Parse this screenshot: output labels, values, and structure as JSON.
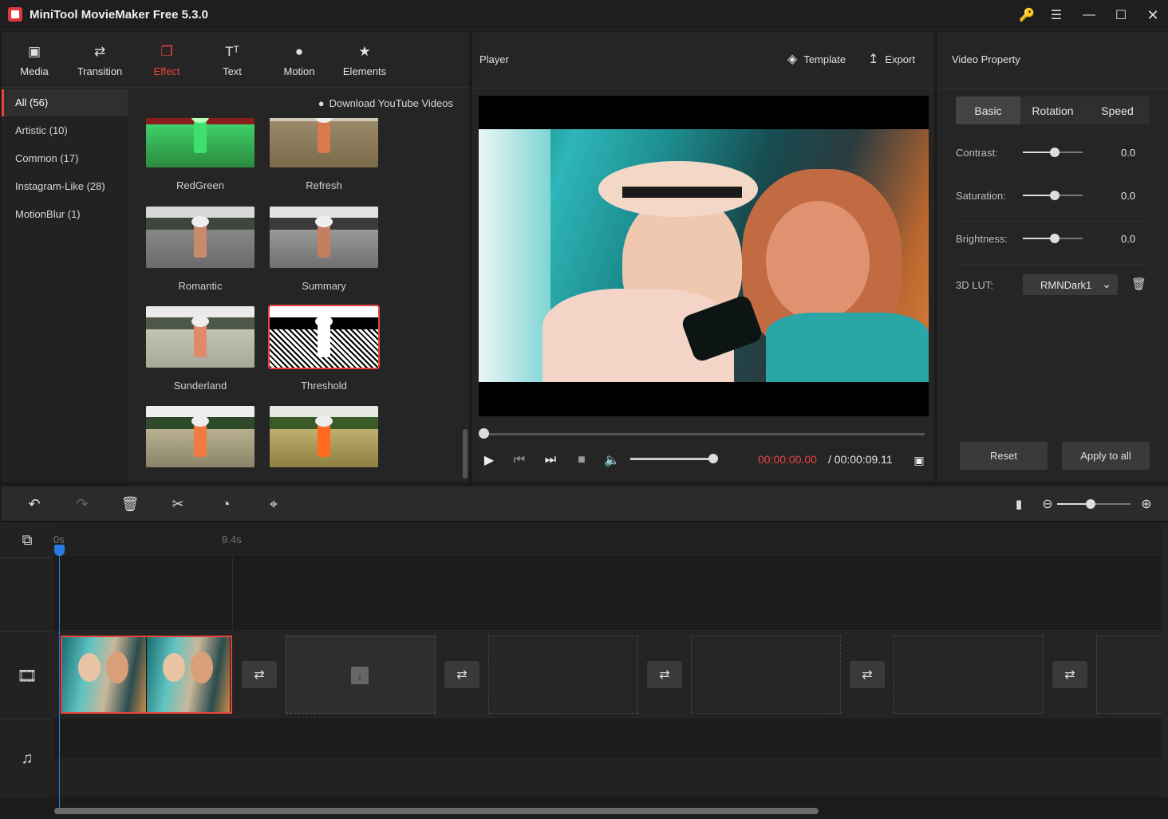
{
  "window": {
    "title": "MiniTool MovieMaker Free 5.3.0",
    "controls": [
      "key-icon",
      "menu-icon",
      "minimize-icon",
      "maximize-icon",
      "close-icon"
    ]
  },
  "library": {
    "tabs": [
      {
        "label": "Media",
        "icon": "media-icon"
      },
      {
        "label": "Transition",
        "icon": "transition-icon"
      },
      {
        "label": "Effect",
        "icon": "effect-icon",
        "active": true
      },
      {
        "label": "Text",
        "icon": "text-icon"
      },
      {
        "label": "Motion",
        "icon": "motion-icon"
      },
      {
        "label": "Elements",
        "icon": "elements-icon"
      }
    ],
    "categories": [
      {
        "label": "All (56)",
        "active": true
      },
      {
        "label": "Artistic (10)"
      },
      {
        "label": "Common (17)"
      },
      {
        "label": "Instagram-Like (28)"
      },
      {
        "label": "MotionBlur (1)"
      }
    ],
    "download_link": "Download YouTube Videos",
    "effects": [
      {
        "label": "RedGreen"
      },
      {
        "label": "Refresh"
      },
      {
        "label": "Romantic"
      },
      {
        "label": "Summary"
      },
      {
        "label": "Sunderland"
      },
      {
        "label": "Threshold",
        "selected": true
      },
      {
        "label": ""
      },
      {
        "label": ""
      }
    ]
  },
  "player": {
    "title": "Player",
    "template_label": "Template",
    "export_label": "Export",
    "time_current": "00:00:00.00",
    "time_total": "/ 00:00:09.11",
    "progress": 0.0,
    "volume": 1.0
  },
  "property": {
    "title": "Video Property",
    "tabs": [
      {
        "label": "Basic",
        "active": true
      },
      {
        "label": "Rotation"
      },
      {
        "label": "Speed"
      }
    ],
    "rows": [
      {
        "label": "Contrast:",
        "value": "0.0"
      },
      {
        "label": "Saturation:",
        "value": "0.0"
      },
      {
        "label": "Brightness:",
        "value": "0.0"
      }
    ],
    "lut_label": "3D LUT:",
    "lut_value": "RMNDark1",
    "reset_label": "Reset",
    "apply_all_label": "Apply to all"
  },
  "timeline": {
    "ruler": [
      "0s",
      "9.4s"
    ],
    "tools": [
      "undo-icon",
      "redo-icon",
      "delete-icon",
      "split-icon",
      "speed-icon",
      "crop-icon"
    ],
    "zoom_level": 0.45
  },
  "colors": {
    "accent": "#e8453c",
    "playhead": "#2a7be0",
    "panel": "#252525"
  }
}
